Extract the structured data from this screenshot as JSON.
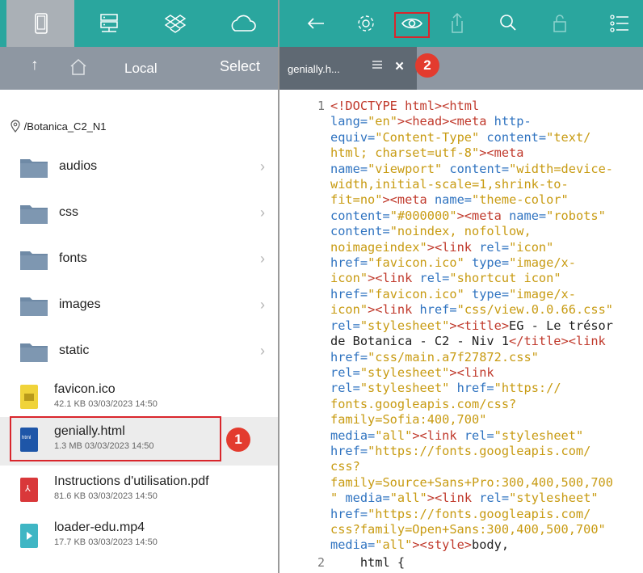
{
  "left_panel": {
    "nav": {
      "up_arrow": "↑",
      "title": "Local",
      "select": "Select"
    },
    "path": "/Botanica_C2_N1",
    "folders": [
      {
        "name": "audios"
      },
      {
        "name": "css"
      },
      {
        "name": "fonts"
      },
      {
        "name": "images"
      },
      {
        "name": "static"
      }
    ],
    "files": [
      {
        "name": "favicon.ico",
        "meta": "42.1 KB 03/03/2023 14:50",
        "type": "ico",
        "icon_label": ""
      },
      {
        "name": "genially.html",
        "meta": "1.3 MB 03/03/2023 14:50",
        "type": "html",
        "icon_label": "html"
      },
      {
        "name": "Instructions d'utilisation.pdf",
        "meta": "81.6 KB 03/03/2023 14:50",
        "type": "pdf",
        "icon_label": ""
      },
      {
        "name": "loader-edu.mp4",
        "meta": "17.7 KB 03/03/2023 14:50",
        "type": "mp4",
        "icon_label": ""
      }
    ],
    "badge_1": "1"
  },
  "right_panel": {
    "tab": {
      "label": "genially.h...",
      "close": "×"
    },
    "badge_2": "2"
  },
  "code_line_numbers": [
    "1",
    "2"
  ],
  "colors": {
    "teal": "#2aa69e",
    "gray_bar": "#8e97a2",
    "highlight_red": "#d9262c"
  }
}
